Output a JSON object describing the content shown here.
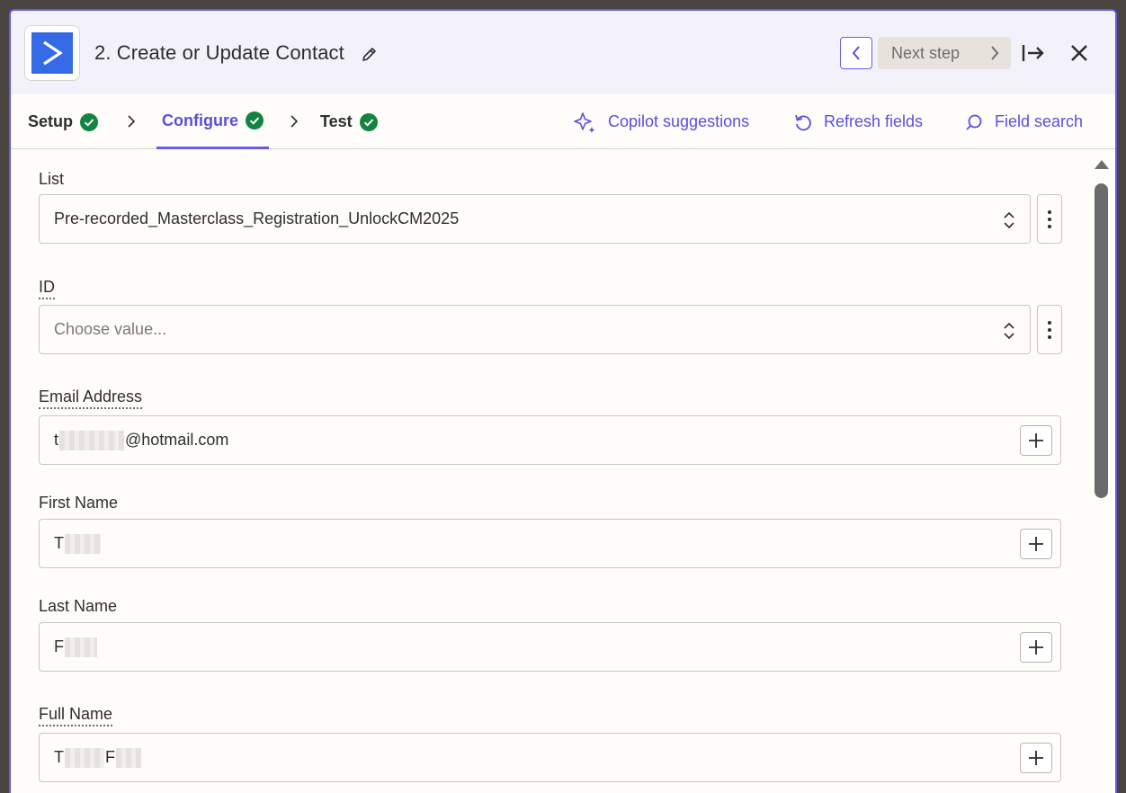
{
  "header": {
    "step_title": "2. Create or Update Contact",
    "next_step_label": "Next step"
  },
  "tabs": [
    {
      "label": "Setup",
      "status": "complete"
    },
    {
      "label": "Configure",
      "status": "complete",
      "active": true
    },
    {
      "label": "Test",
      "status": "complete"
    }
  ],
  "tools": {
    "copilot": "Copilot suggestions",
    "refresh": "Refresh fields",
    "search": "Field search"
  },
  "fields": {
    "list": {
      "label": "List",
      "value": "Pre-recorded_Masterclass_Registration_UnlockCM2025"
    },
    "id": {
      "label": "ID",
      "placeholder": "Choose value..."
    },
    "email": {
      "label": "Email Address",
      "prefix": "t",
      "suffix": "@hotmail.com"
    },
    "first_name": {
      "label": "First Name",
      "prefix": "T"
    },
    "last_name": {
      "label": "Last Name",
      "prefix": "F"
    },
    "full_name": {
      "label": "Full Name",
      "prefix": "T",
      "middle": "F"
    }
  },
  "colors": {
    "accent": "#695be8",
    "success": "#13833f",
    "app_brand": "#356ae6"
  }
}
